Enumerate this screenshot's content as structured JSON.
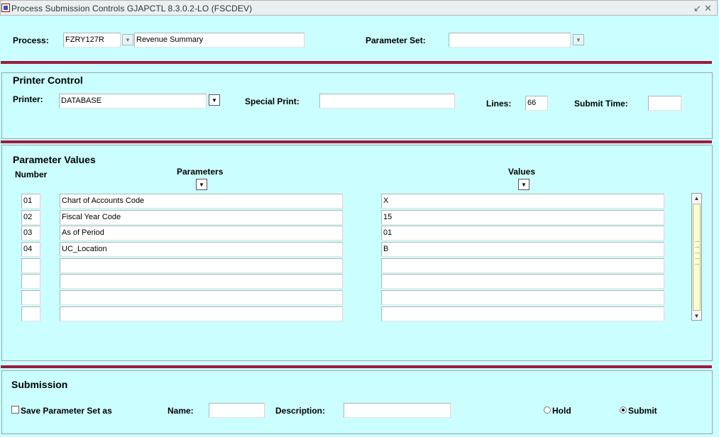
{
  "window": {
    "title": "Process Submission Controls  GJAPCTL  8.3.0.2-LO  (FSCDEV)",
    "minimize_icon": "minimize-icon",
    "close_icon": "close-icon"
  },
  "process": {
    "label": "Process:",
    "code": "FZRY127R",
    "description": "Revenue Summary",
    "parameter_set_label": "Parameter Set:",
    "parameter_set_value": ""
  },
  "printer_control": {
    "title": "Printer Control",
    "printer_label": "Printer:",
    "printer_value": "DATABASE",
    "special_print_label": "Special Print:",
    "special_print_value": "",
    "lines_label": "Lines:",
    "lines_value": "66",
    "submit_time_label": "Submit Time:",
    "submit_time_value": ""
  },
  "parameter_values": {
    "title": "Parameter Values",
    "number_header": "Number",
    "parameters_header": "Parameters",
    "values_header": "Values",
    "rows": [
      {
        "number": "01",
        "parameter": "Chart of Accounts Code",
        "value": "X"
      },
      {
        "number": "02",
        "parameter": "Fiscal Year Code",
        "value": "15"
      },
      {
        "number": "03",
        "parameter": "As of Period",
        "value": "01"
      },
      {
        "number": "04",
        "parameter": "UC_Location",
        "value": "B"
      },
      {
        "number": "",
        "parameter": "",
        "value": ""
      },
      {
        "number": "",
        "parameter": "",
        "value": ""
      },
      {
        "number": "",
        "parameter": "",
        "value": ""
      },
      {
        "number": "",
        "parameter": "",
        "value": ""
      }
    ]
  },
  "submission": {
    "title": "Submission",
    "save_parameter_set_label": "Save Parameter Set as",
    "save_parameter_set_checked": false,
    "name_label": "Name:",
    "name_value": "",
    "description_label": "Description:",
    "description_value": "",
    "hold_label": "Hold",
    "submit_label": "Submit",
    "selected_mode": "Submit"
  },
  "colors": {
    "background": "#cbfefe",
    "separator": "#9b1b3f"
  }
}
